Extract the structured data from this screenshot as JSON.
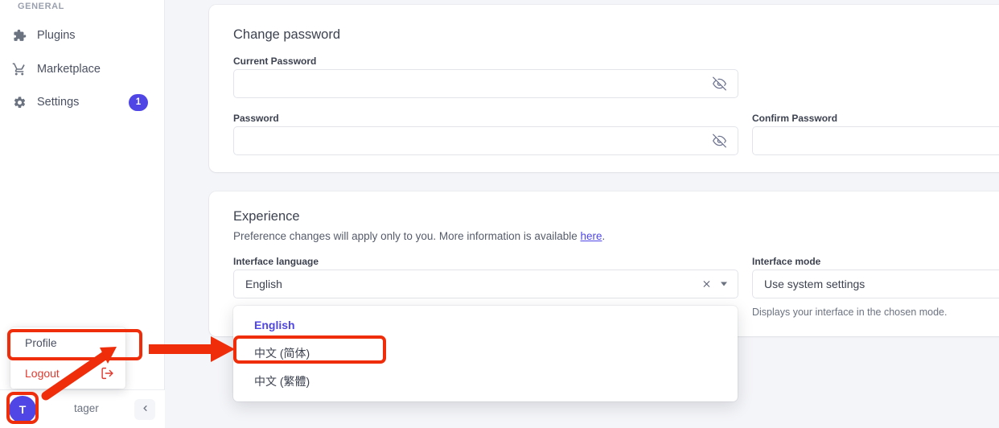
{
  "sidebar": {
    "section_title": "GENERAL",
    "items": [
      {
        "label": "Plugins",
        "icon": "puzzle-icon",
        "badge": null
      },
      {
        "label": "Marketplace",
        "icon": "shopping-cart-icon",
        "badge": null
      },
      {
        "label": "Settings",
        "icon": "gear-icon",
        "badge": "1"
      }
    ],
    "user": {
      "avatar_initial": "T",
      "name": "tager",
      "collapse_icon": "chevron-left-icon"
    },
    "profile_menu": {
      "profile_label": "Profile",
      "logout_label": "Logout",
      "logout_icon": "sign-out-icon"
    }
  },
  "password_card": {
    "title": "Change password",
    "current_password": {
      "label": "Current Password",
      "value": "",
      "placeholder": "",
      "toggle_icon": "eye-off-icon"
    },
    "password": {
      "label": "Password",
      "value": "",
      "placeholder": "",
      "toggle_icon": "eye-off-icon"
    },
    "confirm_password": {
      "label": "Confirm Password",
      "value": "",
      "placeholder": ""
    }
  },
  "experience_card": {
    "title": "Experience",
    "description_before": "Preference changes will apply only to you. More information is available ",
    "description_link": "here",
    "description_after": ".",
    "interface_language": {
      "label": "Interface language",
      "value": "English",
      "clear_icon": "close-x-icon",
      "caret_icon": "chevron-down-icon",
      "options": [
        {
          "label": "English",
          "selected": true
        },
        {
          "label": "中文 (简体)",
          "selected": false
        },
        {
          "label": "中文 (繁體)",
          "selected": false
        }
      ]
    },
    "interface_mode": {
      "label": "Interface mode",
      "value": "Use system settings",
      "hint": "Displays your interface in the chosen mode."
    }
  },
  "annotations": {
    "highlight_color": "#ef2d0a",
    "boxes": [
      "profile-menu-item",
      "avatar-button",
      "chinese-simplified-option"
    ],
    "arrows": [
      "arrow-avatar-to-profile",
      "arrow-profile-to-chinese-option"
    ]
  }
}
